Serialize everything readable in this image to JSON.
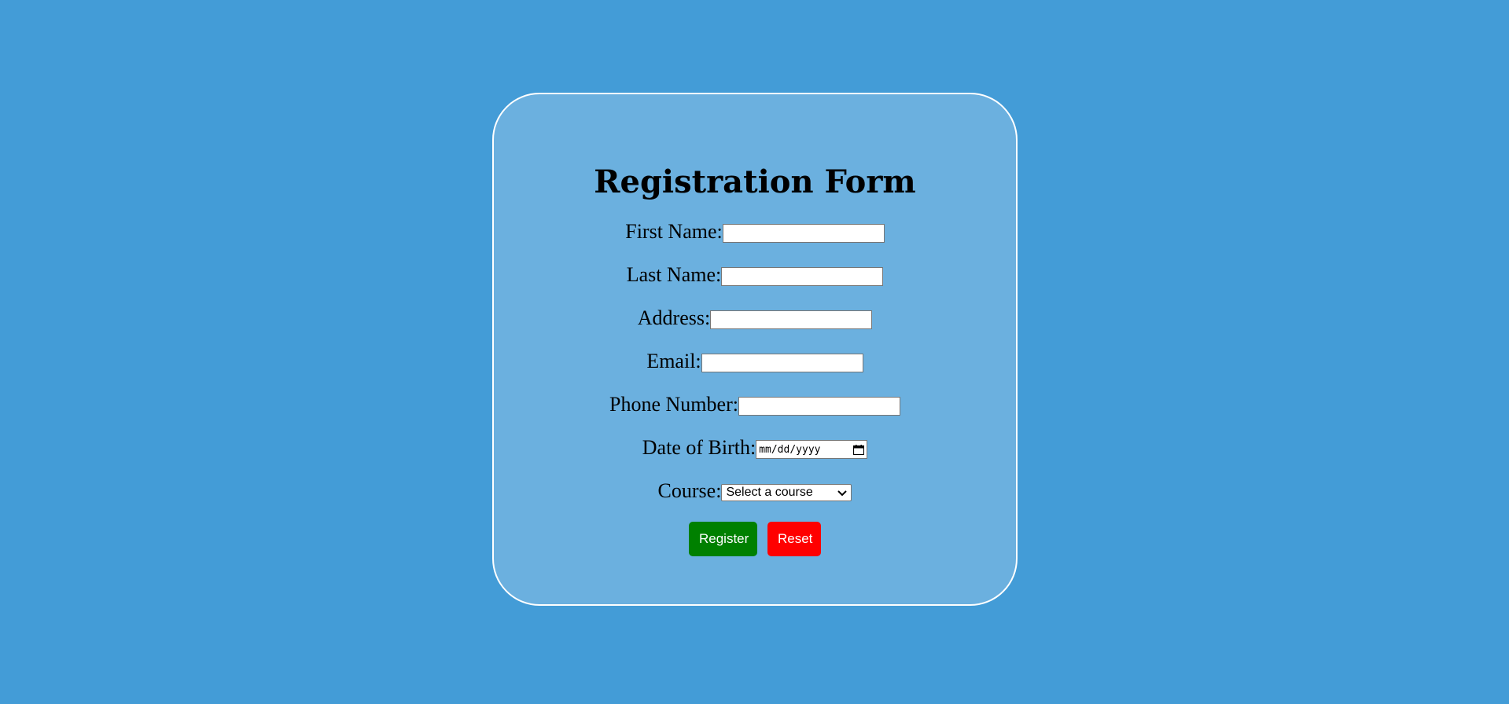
{
  "form": {
    "title": "Registration Form",
    "fields": {
      "first_name": {
        "label": "First Name:",
        "value": ""
      },
      "last_name": {
        "label": "Last Name:",
        "value": ""
      },
      "address": {
        "label": "Address:",
        "value": ""
      },
      "email": {
        "label": "Email:",
        "value": ""
      },
      "phone": {
        "label": "Phone Number:",
        "value": ""
      },
      "dob": {
        "label": "Date of Birth:",
        "placeholder": "mm/dd/yyyy"
      },
      "course": {
        "label": "Course:",
        "selected": "Select a course"
      }
    },
    "buttons": {
      "register": "Register",
      "reset": "Reset"
    }
  },
  "colors": {
    "background": "#439cd7",
    "card": "#6bb0df",
    "register": "#008000",
    "reset": "#ff0000"
  },
  "icons": {
    "date": "calendar-icon",
    "select": "chevron-down-icon"
  }
}
